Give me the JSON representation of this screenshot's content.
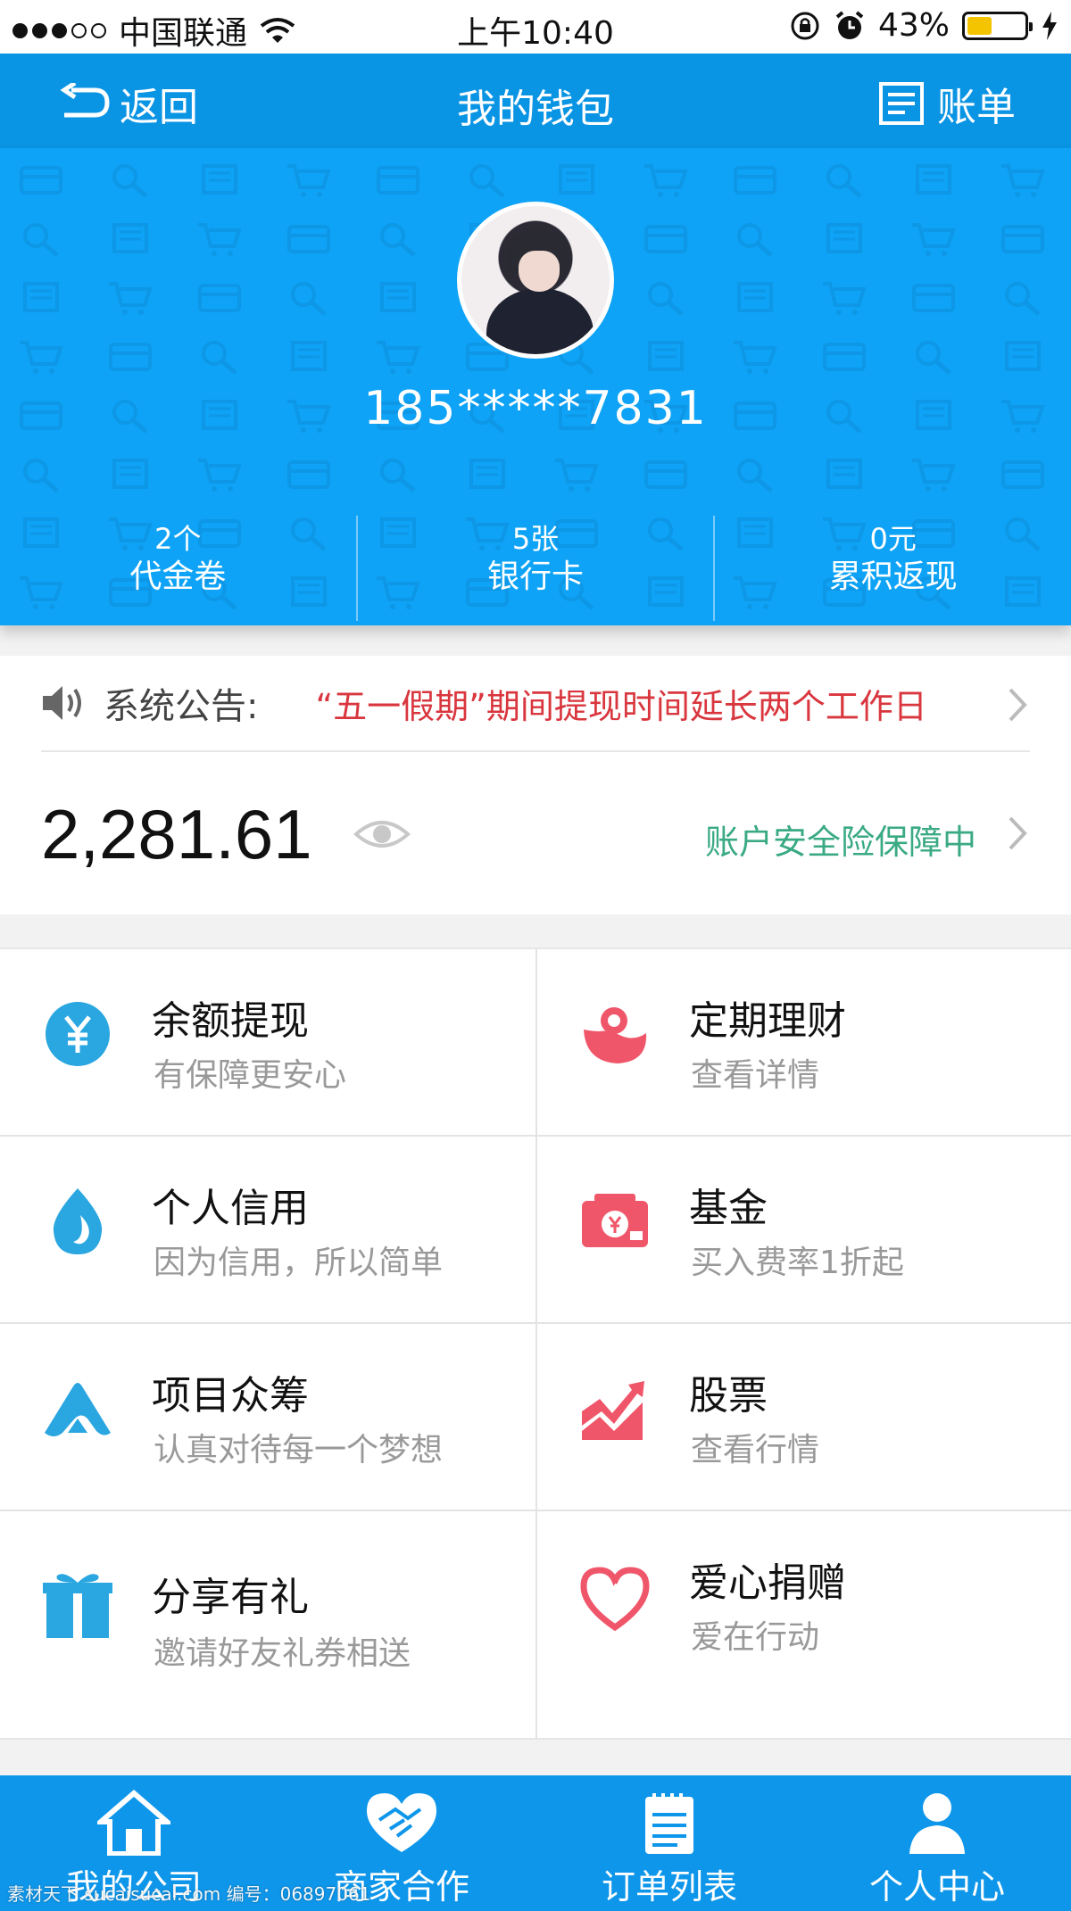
{
  "status_bar": {
    "carrier": "中国联通",
    "time": "上午10:40",
    "battery": "43%",
    "battery_level": 0.43
  },
  "nav": {
    "back_label": "返回",
    "title": "我的钱包",
    "bill_label": "账单"
  },
  "profile": {
    "phone": "185*****7831",
    "stats": [
      {
        "value": "2个",
        "label": "代金卷"
      },
      {
        "value": "5张",
        "label": "银行卡"
      },
      {
        "value": "0元",
        "label": "累积返现"
      }
    ]
  },
  "notice": {
    "label": "系统公告:",
    "text": "“五一假期”期间提现时间延长两个工作日"
  },
  "balance": {
    "amount": "2,281.61",
    "security_text": "账户安全险保障中"
  },
  "features": [
    {
      "title": "余额提现",
      "subtitle": "有保障更安心",
      "icon": "yen-coin-icon",
      "color": "#2aa6e0"
    },
    {
      "title": "定期理财",
      "subtitle": "查看详情",
      "icon": "piggy-bank-icon",
      "color": "#f0566a"
    },
    {
      "title": "个人信用",
      "subtitle": "因为信用，所以简单",
      "icon": "water-drop-icon",
      "color": "#2aa6e0"
    },
    {
      "title": "基金",
      "subtitle": "买入费率1折起",
      "icon": "money-wallet-icon",
      "color": "#f0566a"
    },
    {
      "title": "项目众筹",
      "subtitle": "认真对待每一个梦想",
      "icon": "crowdfunding-icon",
      "color": "#2aa6e0"
    },
    {
      "title": "股票",
      "subtitle": "查看行情",
      "icon": "stock-chart-icon",
      "color": "#f0566a"
    },
    {
      "title": "分享有礼",
      "subtitle": "邀请好友礼券相送",
      "icon": "gift-icon",
      "color": "#2aa6e0"
    },
    {
      "title": "爱心捐赠",
      "subtitle": "爱在行动",
      "icon": "heart-icon",
      "color": "#f0566a"
    }
  ],
  "tabs": [
    {
      "label": "我的公司",
      "icon": "home-icon"
    },
    {
      "label": "商家合作",
      "icon": "handshake-icon"
    },
    {
      "label": "订单列表",
      "icon": "clipboard-icon"
    },
    {
      "label": "个人中心",
      "icon": "user-icon"
    }
  ],
  "watermark": "素材天下 sucaisucai.com  编号：06897061"
}
